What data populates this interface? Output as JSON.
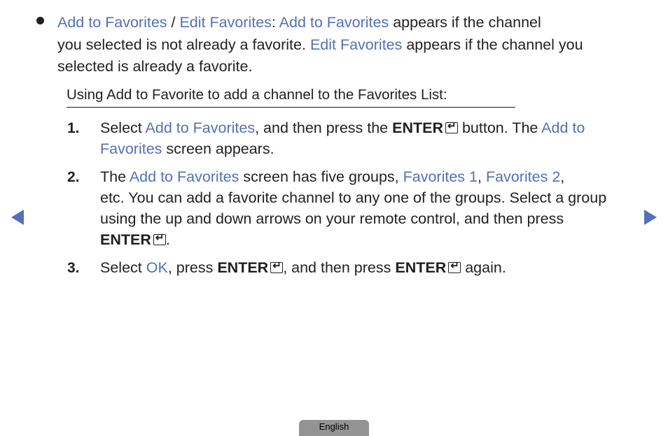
{
  "bullet": {
    "line1": {
      "t1": "Add to Favorites",
      "t2": " / ",
      "t3": "Edit Favorites",
      "t4": ": ",
      "t5": "Add to Favorites",
      "t6": " appears if the channel"
    },
    "line2": {
      "t1": "you selected is not already a favorite. ",
      "t2": "Edit Favorites",
      "t3": " appears if the channel you"
    },
    "line3": "selected is already a favorite."
  },
  "heading": "Using Add to Favorite to add a channel to the Favorites List:",
  "steps": [
    {
      "num": "1.",
      "l1": {
        "t1": "Select ",
        "t2": "Add to Favorites",
        "t3": ", and then press the ",
        "t4": "ENTER",
        "t5": " button. The ",
        "t6": "Add to"
      },
      "l2": {
        "t1": "Favorites",
        "t2": " screen appears."
      }
    },
    {
      "num": "2.",
      "l1": {
        "t1": "The ",
        "t2": "Add to Favorites",
        "t3": " screen has five groups, ",
        "t4": "Favorites 1",
        "t5": ", ",
        "t6": "Favorites 2",
        "t7": ","
      },
      "l2": "etc. You can add a favorite channel to any one of the groups. Select a group",
      "l3": "using the up and down arrows on your remote control, and then press",
      "l4": {
        "t1": "ENTER",
        "t2": "."
      }
    },
    {
      "num": "3.",
      "l1": {
        "t1": "Select ",
        "t2": "OK",
        "t3": ", press ",
        "t4": "ENTER",
        "t5": ", and then press ",
        "t6": "ENTER",
        "t7": " again."
      }
    }
  ],
  "nav": {
    "prev": "previous-page",
    "next": "next-page"
  },
  "language": "English",
  "colors": {
    "accent": "#5470b8",
    "text": "#231f20",
    "lang_tab": "#939393"
  }
}
